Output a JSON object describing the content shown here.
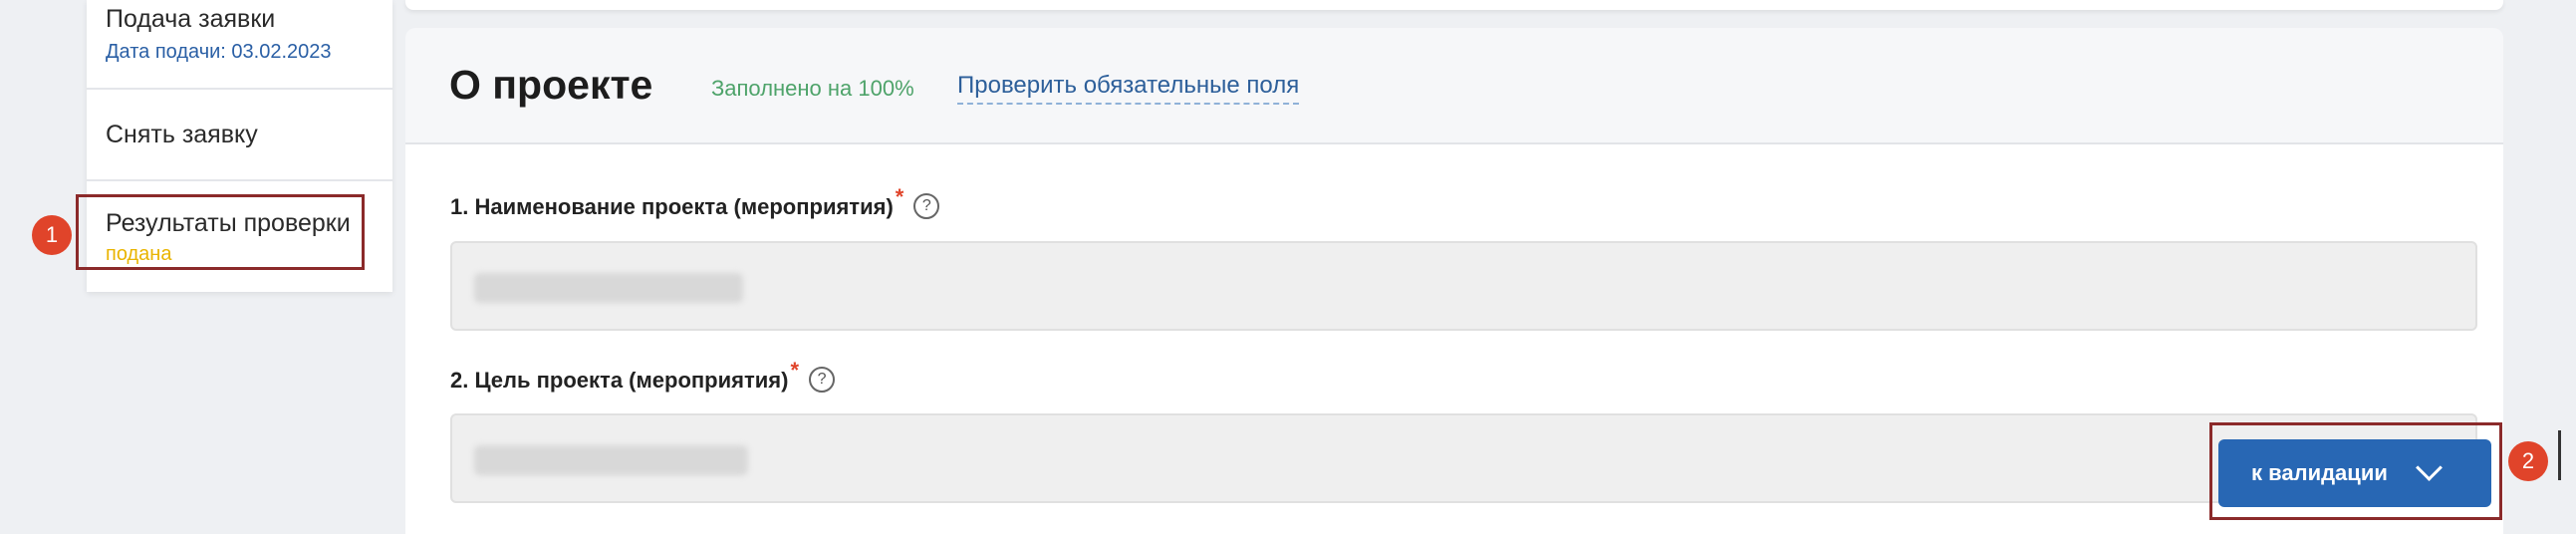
{
  "sidebar": {
    "items": [
      {
        "label": "Подача заявки",
        "sub": "Дата подачи: 03.02.2023"
      },
      {
        "label": "Снять заявку"
      },
      {
        "label": "Результаты проверки",
        "sub": "подана"
      }
    ]
  },
  "annotations": {
    "badge1": "1",
    "badge2": "2"
  },
  "header": {
    "title": "О проекте",
    "fill_status": "Заполнено на 100%",
    "check_link": "Проверить обязательные поля"
  },
  "form": {
    "fields": [
      {
        "label": "1. Наименование проекта (мероприятия)",
        "required_mark": "*",
        "help": "?"
      },
      {
        "label": "2. Цель проекта (мероприятия)",
        "required_mark": "*",
        "help": "?"
      }
    ]
  },
  "validate_button": {
    "label": "к валидации",
    "icon": "chevron-down-icon"
  },
  "colors": {
    "accent": "#2867b4",
    "status_green": "#4ea36a",
    "status_yellow": "#e9b400",
    "required_red": "#e0442a",
    "highlight_border": "#8b2a2a"
  }
}
